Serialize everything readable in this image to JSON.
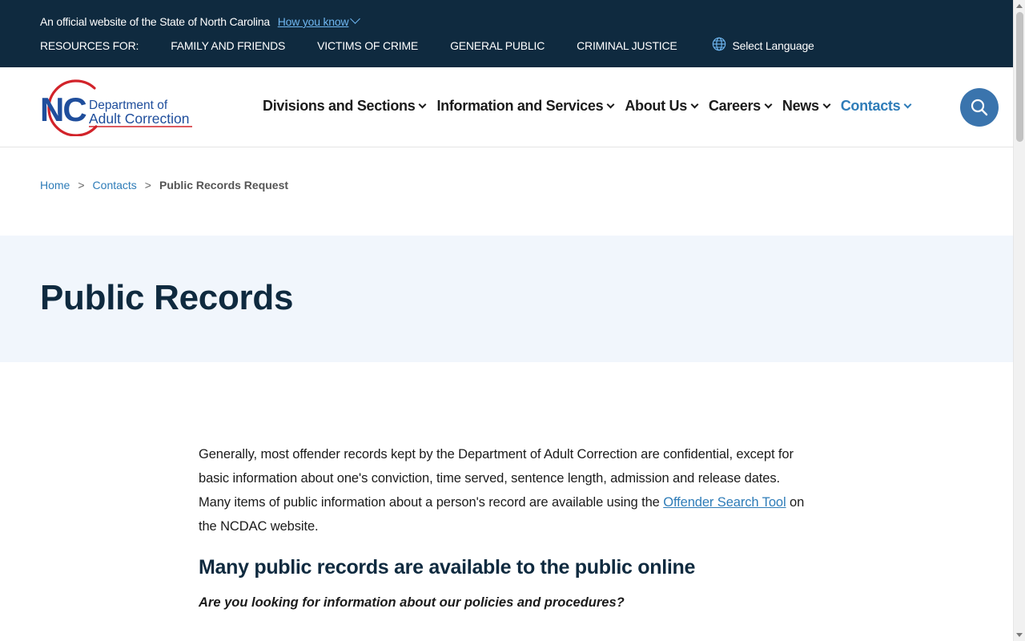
{
  "topbar": {
    "official_text": "An official website of the State of North Carolina",
    "how_you_know": "How you know",
    "resources_label": "RESOURCES FOR:",
    "resource_links": [
      "FAMILY AND FRIENDS",
      "VICTIMS OF CRIME",
      "GENERAL PUBLIC",
      "CRIMINAL JUSTICE"
    ],
    "select_language": "Select Language"
  },
  "header": {
    "logo": {
      "initials": "NC",
      "line1": "Department of",
      "line2": "Adult Correction"
    },
    "nav": [
      "Divisions and Sections",
      "Information and Services",
      "About Us",
      "Careers",
      "News",
      "Contacts"
    ],
    "active_nav": "Contacts",
    "search_icon": "search-icon"
  },
  "breadcrumb": {
    "home": "Home",
    "contacts": "Contacts",
    "current": "Public Records Request",
    "separator": ">"
  },
  "hero": {
    "title": "Public Records"
  },
  "content": {
    "intro_before_link": "Generally, most offender records kept by the Department of Adult Correction are confidential, except for basic information about one's conviction, time served, sentence length, admission and release dates. Many items of public information about a person's record are available using the ",
    "intro_link": "Offender Search Tool",
    "intro_after_link": " on the NCDAC website.",
    "section_heading": "Many public records are available to the public online",
    "question": "Are you looking for information about our policies and procedures?"
  },
  "colors": {
    "topbar_bg": "#0f2a3f",
    "accent_blue": "#2e7cb8",
    "logo_red": "#d2232a",
    "logo_blue": "#1f4e9c",
    "hero_bg": "#f1f6fc",
    "search_button": "#3a74ad"
  }
}
